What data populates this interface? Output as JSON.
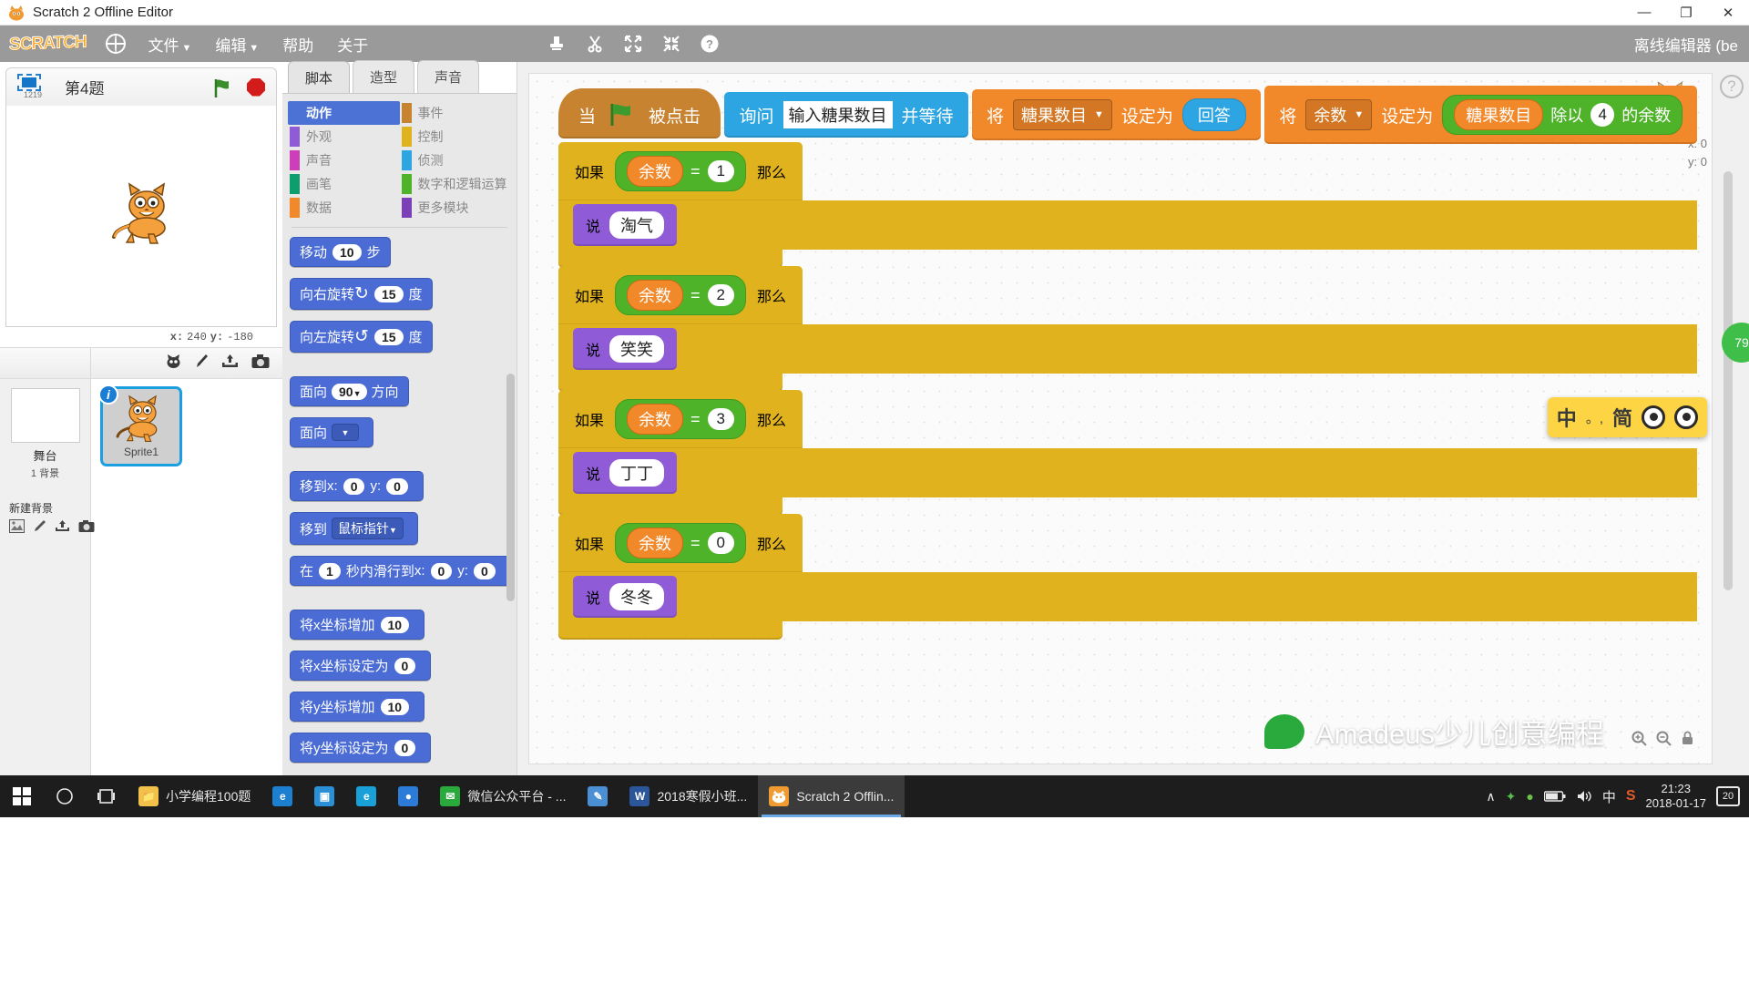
{
  "window": {
    "title": "Scratch 2 Offline Editor",
    "app_icon": "scratch-cat-icon",
    "minimize": "—",
    "maximize": "❐",
    "close": "✕"
  },
  "menubar": {
    "logo": "SCRATCH",
    "language_icon": "globe-icon",
    "items": [
      {
        "label": "文件",
        "caret": "▼"
      },
      {
        "label": "编辑",
        "caret": "▼"
      },
      {
        "label": "帮助",
        "caret": ""
      },
      {
        "label": "关于",
        "caret": ""
      }
    ],
    "tools": [
      {
        "name": "stamp-duplicate-icon",
        "glyph": "⬇"
      },
      {
        "name": "scissors-cut-icon",
        "glyph": "✂"
      },
      {
        "name": "grow-icon",
        "glyph": "⤡"
      },
      {
        "name": "shrink-icon",
        "glyph": "⤢"
      },
      {
        "name": "help-icon",
        "glyph": "?"
      }
    ],
    "right_label": "离线编辑器 (be"
  },
  "stage": {
    "mode_icon_label": "1219",
    "project_title": "第4题",
    "green_flag": "green-flag-icon",
    "stop_sign": "stop-sign-icon",
    "coords": {
      "x_label": "x:",
      "x_value": "240",
      "y_label": "y:",
      "y_value": "-180"
    }
  },
  "sprite_pane": {
    "stage_column": {
      "name": "舞台",
      "backdrop_count": "1",
      "backdrop_word": "背景",
      "new_backdrop_label": "新建背景",
      "new_backdrop_icons": [
        "library-picture-icon",
        "paint-brush-icon",
        "upload-icon",
        "camera-icon"
      ]
    },
    "sprite_toolbar_icons": [
      "new-sprite-library-icon",
      "paint-new-sprite-icon",
      "upload-sprite-icon",
      "camera-sprite-icon"
    ],
    "sprites": [
      {
        "name": "Sprite1",
        "info_badge": "i",
        "selected": true
      }
    ]
  },
  "palette": {
    "tabs": [
      {
        "label": "脚本",
        "active": true
      },
      {
        "label": "造型",
        "active": false
      },
      {
        "label": "声音",
        "active": false
      }
    ],
    "categories_left": [
      {
        "label": "动作",
        "color": "#4b72d4",
        "selected": true
      },
      {
        "label": "外观",
        "color": "#8f5bd6",
        "selected": false
      },
      {
        "label": "声音",
        "color": "#cd3fb8",
        "selected": false
      },
      {
        "label": "画笔",
        "color": "#0e9e6e",
        "selected": false
      },
      {
        "label": "数据",
        "color": "#f1882a",
        "selected": false
      }
    ],
    "categories_right": [
      {
        "label": "事件",
        "color": "#c88330",
        "selected": false
      },
      {
        "label": "控制",
        "color": "#e0b21e",
        "selected": false
      },
      {
        "label": "侦测",
        "color": "#2ca5e2",
        "selected": false
      },
      {
        "label": "数字和逻辑运算",
        "color": "#4fb32a",
        "selected": false
      },
      {
        "label": "更多模块",
        "color": "#7b3fb8",
        "selected": false
      }
    ],
    "blocks": [
      {
        "id": "move",
        "pre": "移动",
        "num": "10",
        "post": "步"
      },
      {
        "id": "turn-right",
        "pre": "向右旋转",
        "icon": "↻",
        "num": "15",
        "post": "度"
      },
      {
        "id": "turn-left",
        "pre": "向左旋转",
        "icon": "↺",
        "num": "15",
        "post": "度"
      },
      {
        "id": "point-in-direction",
        "pre": "面向",
        "num": "90",
        "caret": "▼",
        "post": "方向"
      },
      {
        "id": "point-towards",
        "pre": "面向",
        "caret": "▼",
        "post": ""
      },
      {
        "id": "go-to-xy",
        "pre": "移到",
        "lx": "x:",
        "nx": "0",
        "ly": "y:",
        "ny": "0"
      },
      {
        "id": "go-to-mouse",
        "pre": "移到",
        "drop": "鼠标指针",
        "caret": "▼"
      },
      {
        "id": "glide-secs",
        "pre": "在",
        "num": "1",
        "mid": "秒内滑行到",
        "lx": "x:",
        "nx": "0",
        "ly": "y:",
        "ny": "0"
      },
      {
        "id": "change-x-by",
        "pre": "将x坐标增加",
        "num": "10"
      },
      {
        "id": "set-x-to",
        "pre": "将x坐标设定为",
        "num": "0"
      },
      {
        "id": "change-y-by",
        "pre": "将y坐标增加",
        "num": "10"
      },
      {
        "id": "set-y-to",
        "pre": "将y坐标设定为",
        "num": "0"
      }
    ]
  },
  "script": {
    "hat": {
      "when": "当",
      "flag": "green-flag-icon",
      "clicked": "被点击"
    },
    "ask": {
      "verb": "询问",
      "prompt": "输入糖果数目",
      "wait": "并等待"
    },
    "set_candy": {
      "verb": "将",
      "var": "糖果数目",
      "caret": "▼",
      "to": "设定为",
      "value": "回答"
    },
    "set_mod": {
      "verb": "将",
      "var": "余数",
      "caret": "▼",
      "to": "设定为",
      "op_left": "糖果数目",
      "op_mid": "除以",
      "op_num": "4",
      "op_right": "的余数"
    },
    "if_keyword": "如果",
    "then_keyword": "那么",
    "say_keyword": "说",
    "equals": "=",
    "branches": [
      {
        "var": "余数",
        "value": "1",
        "say": "淘气"
      },
      {
        "var": "余数",
        "value": "2",
        "say": "笑笑"
      },
      {
        "var": "余数",
        "value": "3",
        "say": "丁丁"
      },
      {
        "var": "余数",
        "value": "0",
        "say": "冬冬"
      }
    ],
    "watermark_coords": {
      "x": "x: 0",
      "y": "y: 0"
    },
    "green_tab_label": "79",
    "help_icon": "?"
  },
  "ime": {
    "mode": "中",
    "punct": "。,",
    "simplified": "简",
    "toggle_a": "ime-toggle-icon",
    "toggle_b": "ime-toggle-icon"
  },
  "watermark": {
    "text": "Amadeus少儿创意编程",
    "icon": "wechat-icon"
  },
  "taskbar": {
    "start_icon": "windows-start-icon",
    "search_icon": "search-circle-icon",
    "taskview_icon": "task-view-icon",
    "apps": [
      {
        "label": "小学编程100题",
        "icon_glyph": "📁",
        "icon_color": "#f2c14b",
        "active": false
      },
      {
        "label": "",
        "icon_glyph": "e",
        "icon_color": "#1d7fd0",
        "active": false
      },
      {
        "label": "",
        "icon_glyph": "▣",
        "icon_color": "#2b8fd6",
        "active": false
      },
      {
        "label": "",
        "icon_glyph": "e",
        "icon_color": "#1aa0d8",
        "active": false
      },
      {
        "label": "",
        "icon_glyph": "●",
        "icon_color": "#2d7bd8",
        "active": false
      },
      {
        "label": "微信公众平台 - ...",
        "icon_glyph": "✉",
        "icon_color": "#2aaa3c",
        "active": false
      },
      {
        "label": "",
        "icon_glyph": "✎",
        "icon_color": "#4b8fd4",
        "active": false
      },
      {
        "label": "2018寒假小班...",
        "icon_glyph": "W",
        "icon_color": "#2b579a",
        "active": false
      },
      {
        "label": "Scratch 2 Offlin...",
        "icon_glyph": "🐱",
        "icon_color": "#f09a32",
        "active": true
      }
    ],
    "tray": {
      "chevron": "∧",
      "icons": [
        {
          "name": "shield-green-icon",
          "glyph": "✦",
          "color": "#58c14b"
        },
        {
          "name": "browser-green-icon",
          "glyph": "●",
          "color": "#6cc04a"
        },
        {
          "name": "battery-icon",
          "glyph": "▭",
          "color": "#e8e8e8"
        },
        {
          "name": "volume-icon",
          "glyph": "🔊",
          "color": "#e8e8e8"
        },
        {
          "name": "ime-chinese-icon",
          "glyph": "中",
          "color": "#e8e8e8"
        },
        {
          "name": "sogou-icon",
          "glyph": "S",
          "color": "#e05a2b"
        }
      ],
      "time": "21:23",
      "date": "2018-01-17",
      "notification_count": "20"
    }
  }
}
